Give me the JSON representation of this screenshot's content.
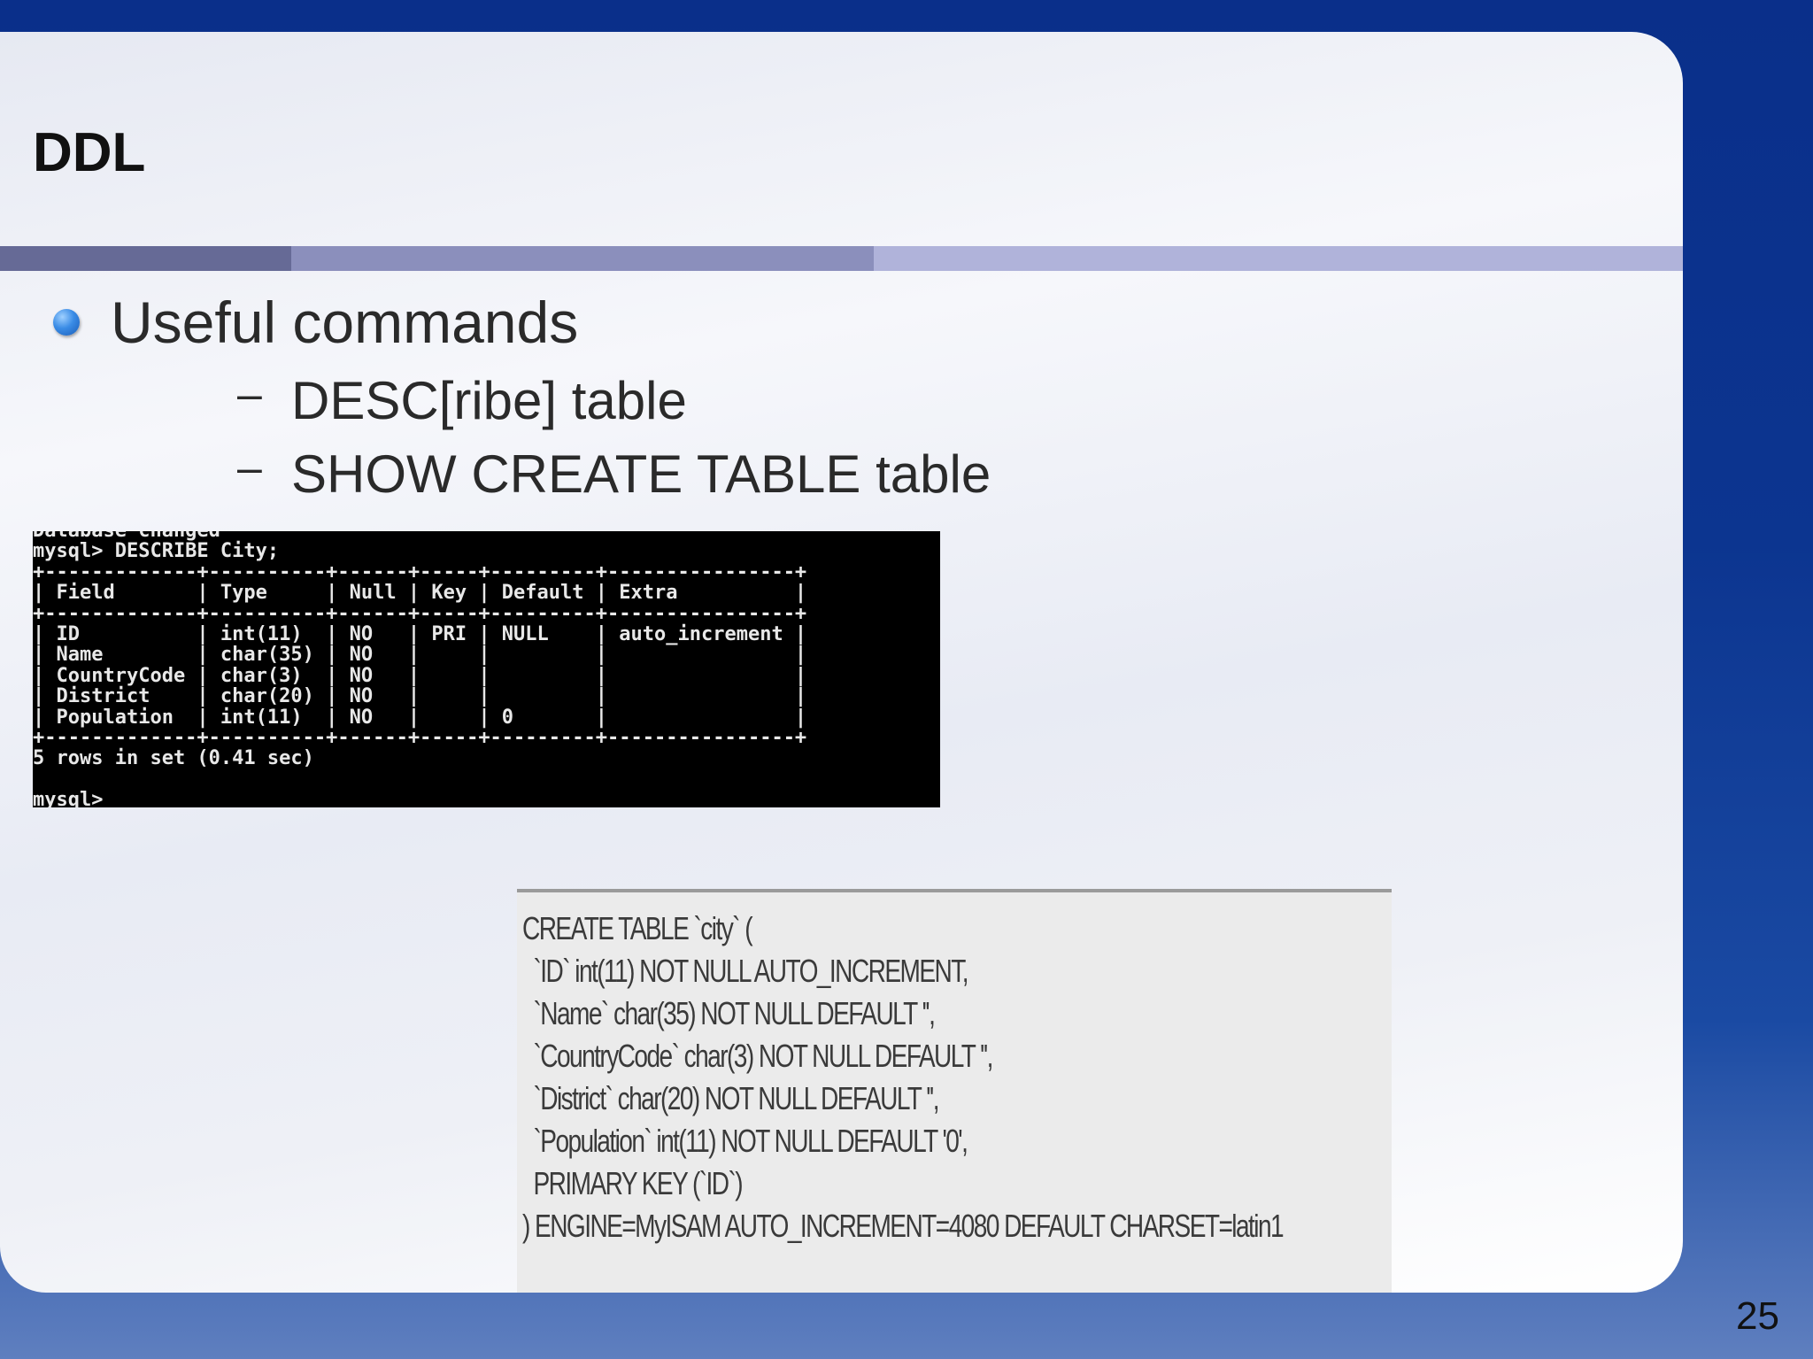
{
  "slide": {
    "title": "DDL",
    "bullet": "Useful commands",
    "subitems": [
      {
        "dash": "–",
        "text": "DESC[ribe] table"
      },
      {
        "dash": "–",
        "text": "SHOW CREATE TABLE table"
      }
    ],
    "page_number": "25"
  },
  "console": {
    "lines": [
      "Database changed",
      "mysql> DESCRIBE City;",
      "+-------------+----------+------+-----+---------+----------------+",
      "| Field       | Type     | Null | Key | Default | Extra          |",
      "+-------------+----------+------+-----+---------+----------------+",
      "| ID          | int(11)  | NO   | PRI | NULL    | auto_increment |",
      "| Name        | char(35) | NO   |     |         |                |",
      "| CountryCode | char(3)  | NO   |     |         |                |",
      "| District    | char(20) | NO   |     |         |                |",
      "| Population  | int(11)  | NO   |     | 0       |                |",
      "+-------------+----------+------+-----+---------+----------------+",
      "5 rows in set (0.41 sec)",
      "",
      "mysql>"
    ]
  },
  "create_statement": {
    "lines": [
      "CREATE TABLE `city` (",
      "  `ID` int(11) NOT NULL AUTO_INCREMENT,",
      "  `Name` char(35) NOT NULL DEFAULT '',",
      "  `CountryCode` char(3) NOT NULL DEFAULT '',",
      "  `District` char(20) NOT NULL DEFAULT '',",
      "  `Population` int(11) NOT NULL DEFAULT '0',",
      "  PRIMARY KEY (`ID`)",
      ") ENGINE=MyISAM AUTO_INCREMENT=4080 DEFAULT CHARSET=latin1"
    ]
  }
}
